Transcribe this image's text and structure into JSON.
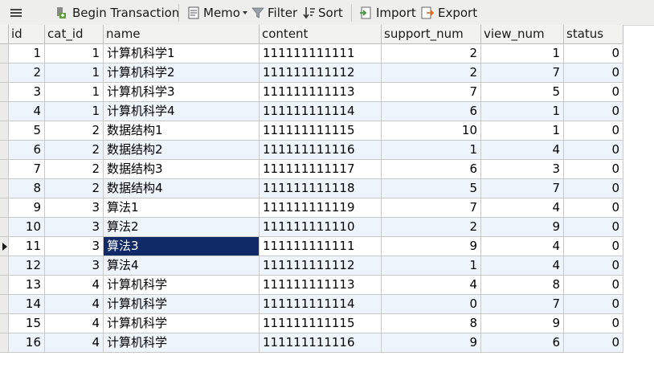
{
  "toolbar": {
    "begin_transaction": "Begin Transaction",
    "memo": "Memo",
    "filter": "Filter",
    "sort": "Sort",
    "import": "Import",
    "export": "Export"
  },
  "columns": [
    "id",
    "cat_id",
    "name",
    "content",
    "support_num",
    "view_num",
    "status"
  ],
  "rows": [
    [
      "1",
      "1",
      "计算机科学1",
      "111111111111",
      "2",
      "1",
      "0"
    ],
    [
      "2",
      "1",
      "计算机科学2",
      "111111111112",
      "2",
      "7",
      "0"
    ],
    [
      "3",
      "1",
      "计算机科学3",
      "111111111113",
      "7",
      "5",
      "0"
    ],
    [
      "4",
      "1",
      "计算机科学4",
      "111111111114",
      "6",
      "1",
      "0"
    ],
    [
      "5",
      "2",
      "数据结构1",
      "111111111115",
      "10",
      "1",
      "0"
    ],
    [
      "6",
      "2",
      "数据结构2",
      "111111111116",
      "1",
      "4",
      "0"
    ],
    [
      "7",
      "2",
      "数据结构3",
      "111111111117",
      "6",
      "3",
      "0"
    ],
    [
      "8",
      "2",
      "数据结构4",
      "111111111118",
      "5",
      "7",
      "0"
    ],
    [
      "9",
      "3",
      "算法1",
      "111111111119",
      "7",
      "4",
      "0"
    ],
    [
      "10",
      "3",
      "算法2",
      "111111111110",
      "2",
      "9",
      "0"
    ],
    [
      "11",
      "3",
      "算法3",
      "111111111111",
      "9",
      "4",
      "0"
    ],
    [
      "12",
      "3",
      "算法4",
      "111111111112",
      "1",
      "4",
      "0"
    ],
    [
      "13",
      "4",
      "计算机科学",
      "111111111113",
      "4",
      "8",
      "0"
    ],
    [
      "14",
      "4",
      "计算机科学",
      "111111111114",
      "0",
      "7",
      "0"
    ],
    [
      "15",
      "4",
      "计算机科学",
      "111111111115",
      "8",
      "9",
      "0"
    ],
    [
      "16",
      "4",
      "计算机科学",
      "111111111116",
      "9",
      "6",
      "0"
    ]
  ],
  "selected_row": 10,
  "selected_column": "name",
  "colors": {
    "selection": "#0f2a66",
    "alt_row": "#eef4fb",
    "toolbar_bg": "#eeeeec"
  }
}
